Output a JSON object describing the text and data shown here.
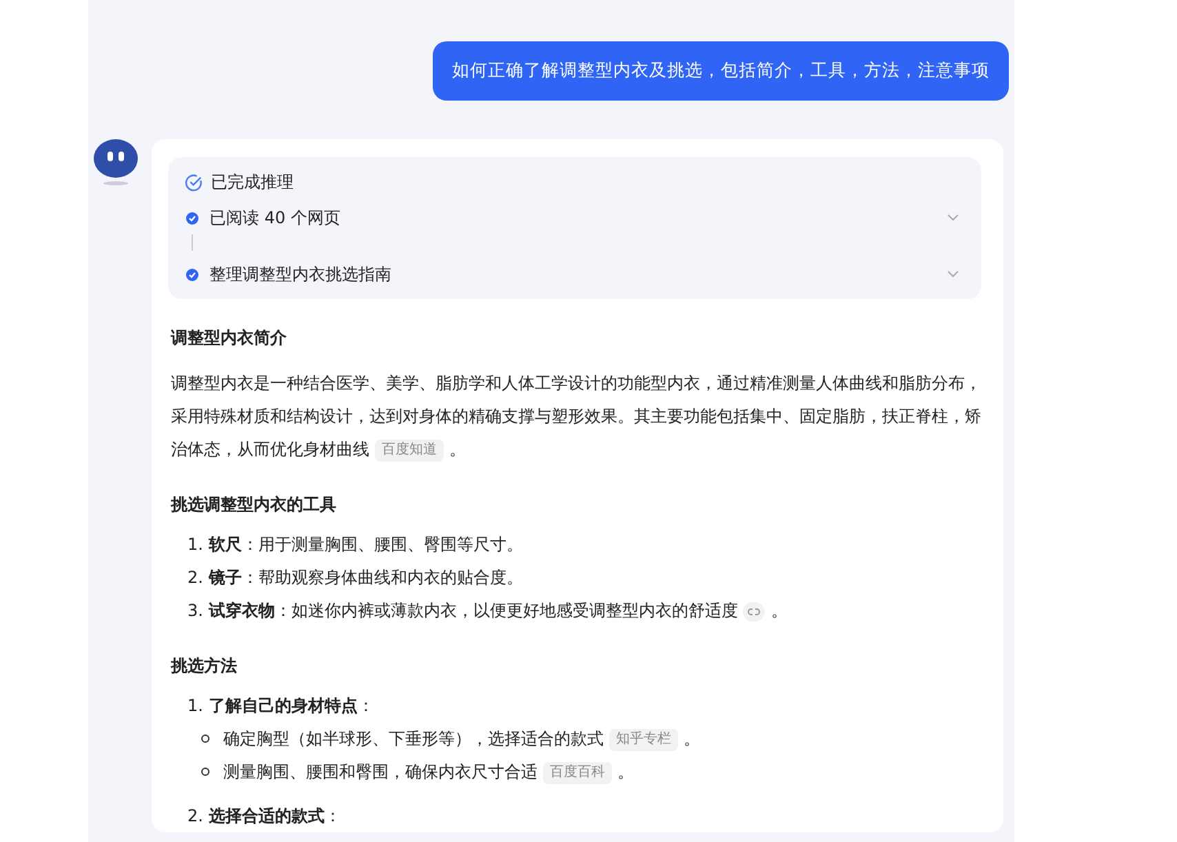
{
  "user_message": "如何正确了解调整型内衣及挑选，包括简介，工具，方法，注意事项",
  "reasoning": {
    "title": "已完成推理",
    "steps": [
      {
        "label": "已阅读 40 个网页"
      },
      {
        "label": "整理调整型内衣挑选指南"
      }
    ]
  },
  "sections": [
    {
      "heading": "调整型内衣简介",
      "paragraph": {
        "text": "调整型内衣是一种结合医学、美学、脂肪学和人体工学设计的功能型内衣，通过精准测量人体曲线和脂肪分布，采用特殊材质和结构设计，达到对身体的精确支撑与塑形效果。其主要功能包括集中、固定脂肪，扶正脊柱，矫治体态，从而优化身材曲线",
        "cite": {
          "kind": "source",
          "label": "百度知道"
        },
        "end": "。"
      }
    },
    {
      "heading": "挑选调整型内衣的工具",
      "list": [
        {
          "number": "1.",
          "text": "**软尺**：用于测量胸围、腰围、臀围等尺寸。"
        },
        {
          "number": "2.",
          "text": "**镜子**：帮助观察身体曲线和内衣的贴合度。"
        },
        {
          "number": "3.",
          "text": "**试穿衣物**：如迷你内裤或薄款内衣，以便更好地感受调整型内衣的舒适度",
          "cite": {
            "kind": "link"
          },
          "end": "。"
        }
      ]
    },
    {
      "heading": "挑选方法",
      "list": [
        {
          "number": "1.",
          "text": "**了解自己的身材特点**：",
          "bullets": [
            {
              "text": "确定胸型（如半球形、下垂形等），选择适合的款式",
              "cite": {
                "kind": "source",
                "label": "知乎专栏"
              },
              "end": "。"
            },
            {
              "text": "测量胸围、腰围和臀围，确保内衣尺寸合适",
              "cite": {
                "kind": "source",
                "label": "百度百科"
              },
              "end": "。"
            }
          ]
        },
        {
          "number": "2.",
          "text": "**选择合适的款式**："
        }
      ]
    }
  ]
}
